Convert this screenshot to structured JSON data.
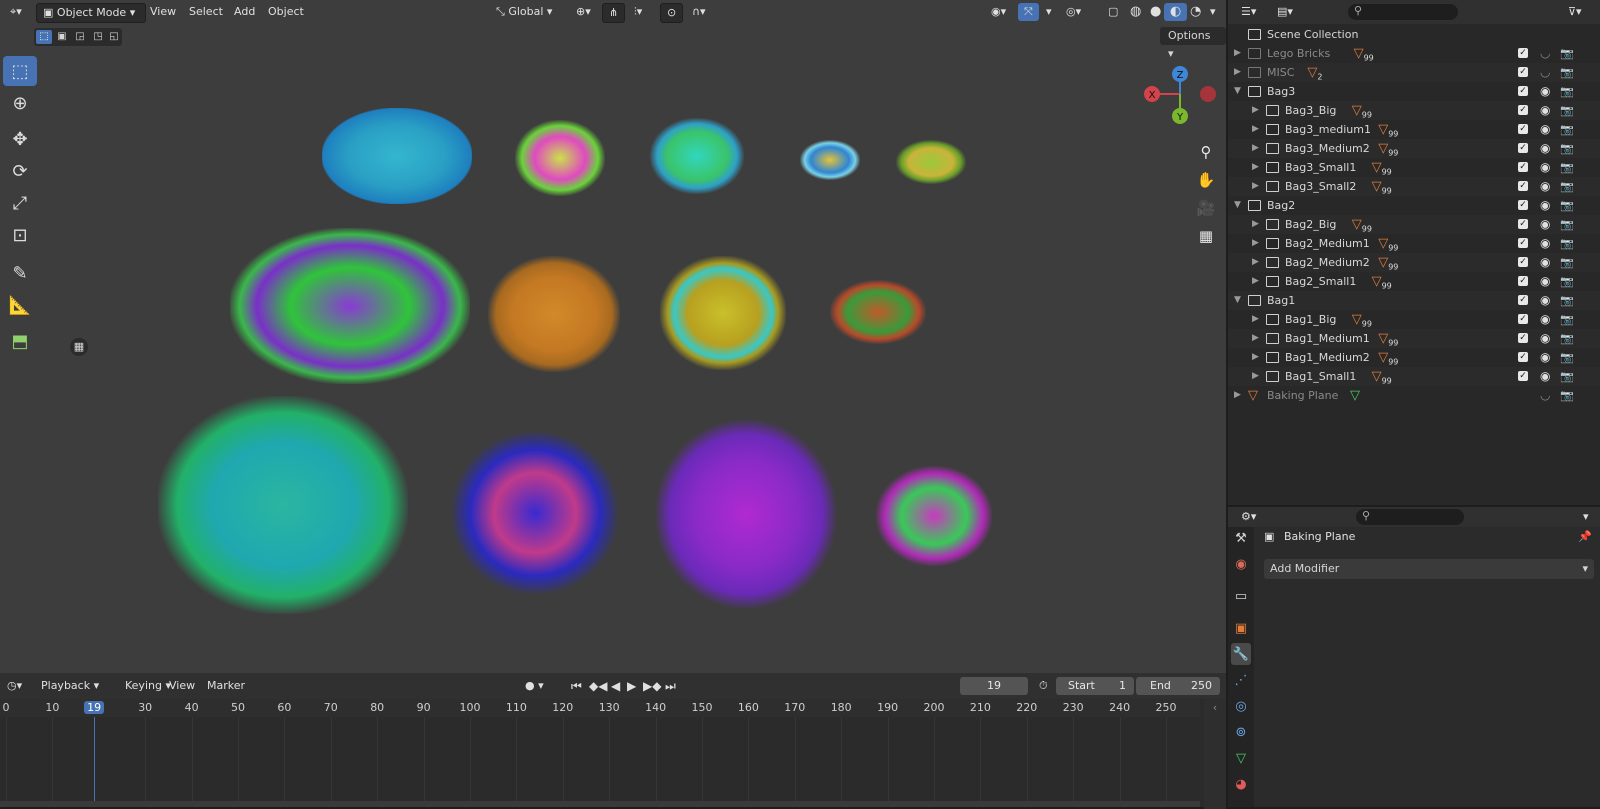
{
  "viewport": {
    "mode": "Object Mode",
    "menus": [
      "View",
      "Select",
      "Add",
      "Object"
    ],
    "transform_orientation": "Global",
    "options_label": "Options",
    "gizmo": {
      "x": "X",
      "y": "Y",
      "z": "Z"
    },
    "tools": [
      "select-box-icon",
      "cursor-icon",
      "move-icon",
      "rotate-icon",
      "scale-icon",
      "transform-icon",
      "annotate-icon",
      "measure-icon",
      "add-cube-icon"
    ]
  },
  "timeline": {
    "menus": [
      "Playback",
      "Keying",
      "View",
      "Marker"
    ],
    "current_frame": "19",
    "start_label": "Start",
    "start_value": "1",
    "end_label": "End",
    "end_value": "250",
    "ruler": [
      "0",
      "10",
      "19",
      "30",
      "40",
      "50",
      "60",
      "70",
      "80",
      "90",
      "100",
      "110",
      "120",
      "130",
      "140",
      "150",
      "160",
      "170",
      "180",
      "190",
      "200",
      "210",
      "220",
      "230",
      "240",
      "250"
    ]
  },
  "outliner": {
    "root": "Scene Collection",
    "rows": [
      {
        "label": "Lego Bricks",
        "badge": "99",
        "dim": true,
        "level": 1
      },
      {
        "label": "MISC",
        "badge": "2",
        "dim": true,
        "level": 1
      },
      {
        "label": "Bag3",
        "badge": "",
        "dim": false,
        "level": 1
      },
      {
        "label": "Bag3_Big",
        "badge": "99",
        "dim": false,
        "level": 2
      },
      {
        "label": "Bag3_medium1",
        "badge": "99",
        "dim": false,
        "level": 2
      },
      {
        "label": "Bag3_Medium2",
        "badge": "99",
        "dim": false,
        "level": 2
      },
      {
        "label": "Bag3_Small1",
        "badge": "99",
        "dim": false,
        "level": 2
      },
      {
        "label": "Bag3_Small2",
        "badge": "99",
        "dim": false,
        "level": 2
      },
      {
        "label": "Bag2",
        "badge": "",
        "dim": false,
        "level": 1
      },
      {
        "label": "Bag2_Big",
        "badge": "99",
        "dim": false,
        "level": 2
      },
      {
        "label": "Bag2_Medium1",
        "badge": "99",
        "dim": false,
        "level": 2
      },
      {
        "label": "Bag2_Medium2",
        "badge": "99",
        "dim": false,
        "level": 2
      },
      {
        "label": "Bag2_Small1",
        "badge": "99",
        "dim": false,
        "level": 2
      },
      {
        "label": "Bag1",
        "badge": "",
        "dim": false,
        "level": 1
      },
      {
        "label": "Bag1_Big",
        "badge": "99",
        "dim": false,
        "level": 2
      },
      {
        "label": "Bag1_Medium1",
        "badge": "99",
        "dim": false,
        "level": 2
      },
      {
        "label": "Bag1_Medium2",
        "badge": "99",
        "dim": false,
        "level": 2
      },
      {
        "label": "Bag1_Small1",
        "badge": "99",
        "dim": false,
        "level": 2
      },
      {
        "label": "Baking Plane",
        "badge": "",
        "dim": true,
        "level": 1
      }
    ]
  },
  "properties": {
    "object_name": "Baking Plane",
    "add_modifier_label": "Add Modifier"
  },
  "colors": {
    "accent": "#4772b3",
    "viewport_bg": "#3d3d3d",
    "x_axis": "#d2434a",
    "y_axis": "#7bb82d",
    "z_axis": "#3f86d6",
    "mesh_icon": "#e07b39"
  }
}
